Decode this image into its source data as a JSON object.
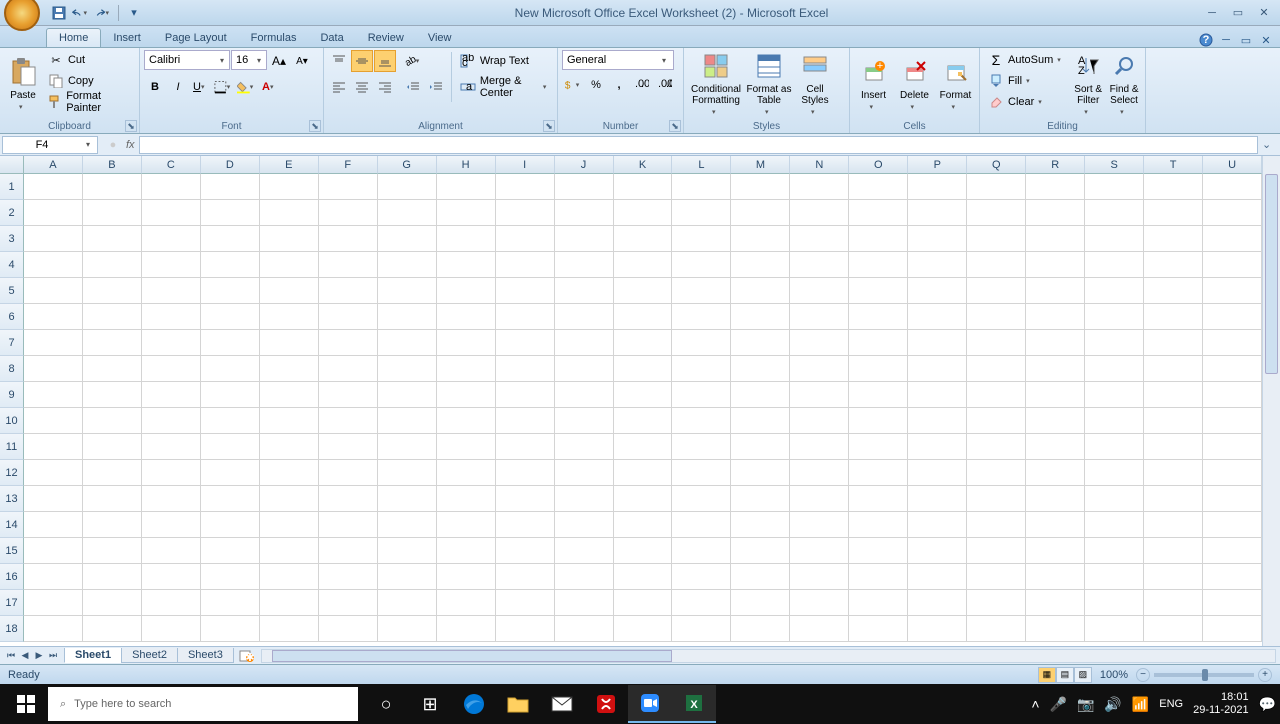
{
  "title": "New Microsoft Office Excel Worksheet (2) - Microsoft Excel",
  "tabs": [
    "Home",
    "Insert",
    "Page Layout",
    "Formulas",
    "Data",
    "Review",
    "View"
  ],
  "active_tab": 0,
  "clipboard": {
    "paste": "Paste",
    "cut": "Cut",
    "copy": "Copy",
    "format_painter": "Format Painter",
    "label": "Clipboard"
  },
  "font": {
    "name": "Calibri",
    "size": "16",
    "label": "Font"
  },
  "alignment": {
    "wrap": "Wrap Text",
    "merge": "Merge & Center",
    "label": "Alignment"
  },
  "number": {
    "format": "General",
    "label": "Number"
  },
  "styles": {
    "conditional": "Conditional Formatting",
    "format_table": "Format as Table",
    "cell_styles": "Cell Styles",
    "label": "Styles"
  },
  "cells": {
    "insert": "Insert",
    "delete": "Delete",
    "format": "Format",
    "label": "Cells"
  },
  "editing": {
    "autosum": "AutoSum",
    "fill": "Fill",
    "clear": "Clear",
    "sort": "Sort & Filter",
    "find": "Find & Select",
    "label": "Editing"
  },
  "name_box": "F4",
  "columns": [
    "A",
    "B",
    "C",
    "D",
    "E",
    "F",
    "G",
    "H",
    "I",
    "J",
    "K",
    "L",
    "M",
    "N",
    "O",
    "P",
    "Q",
    "R",
    "S",
    "T",
    "U"
  ],
  "rows": [
    1,
    2,
    3,
    4,
    5,
    6,
    7,
    8,
    9,
    10,
    11,
    12,
    13,
    14,
    15,
    16,
    17,
    18
  ],
  "sheets": [
    "Sheet1",
    "Sheet2",
    "Sheet3"
  ],
  "active_sheet": 0,
  "status": "Ready",
  "zoom": "100%",
  "search_placeholder": "Type here to search",
  "lang": "ENG",
  "time": "18:01",
  "date": "29-11-2021"
}
